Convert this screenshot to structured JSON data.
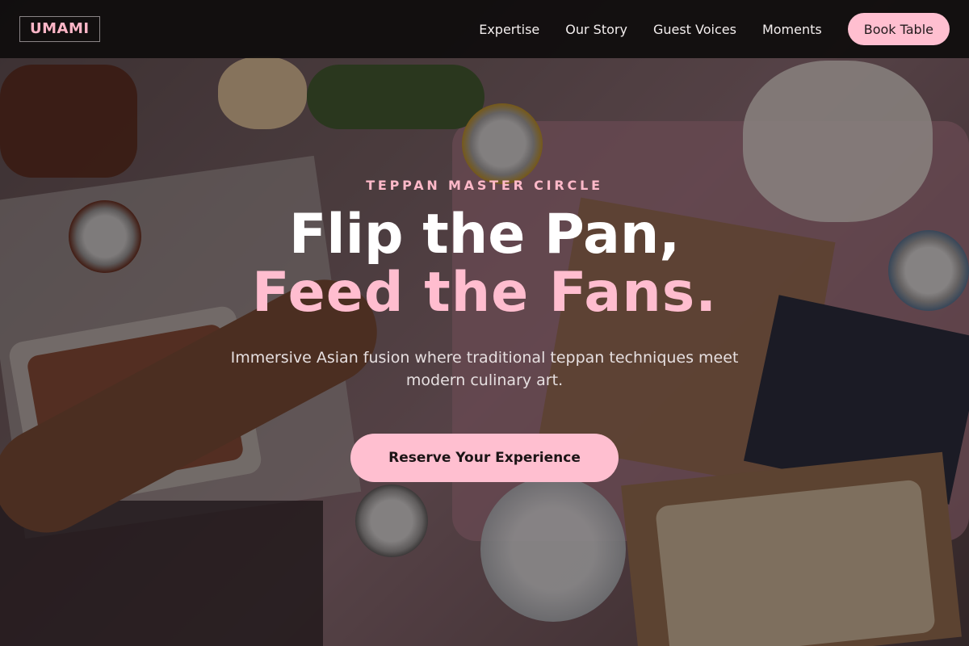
{
  "brand": {
    "logo_text": "UMAMI"
  },
  "nav": {
    "links": [
      "Expertise",
      "Our Story",
      "Guest Voices",
      "Moments"
    ],
    "book_label": "Book Table"
  },
  "hero": {
    "eyebrow": "TEPPAN MASTER CIRCLE",
    "headline_line1": "Flip the Pan,",
    "headline_line2": "Feed the Fans.",
    "subtitle": "Immersive Asian fusion where traditional teppan techniques meet modern culinary art.",
    "cta_label": "Reserve Your Experience",
    "background": "food-spread-photo"
  },
  "colors": {
    "accent": "#ffbfd0",
    "accent_text": "#ffb9c9",
    "nav_bg": "#0e0c0c"
  }
}
